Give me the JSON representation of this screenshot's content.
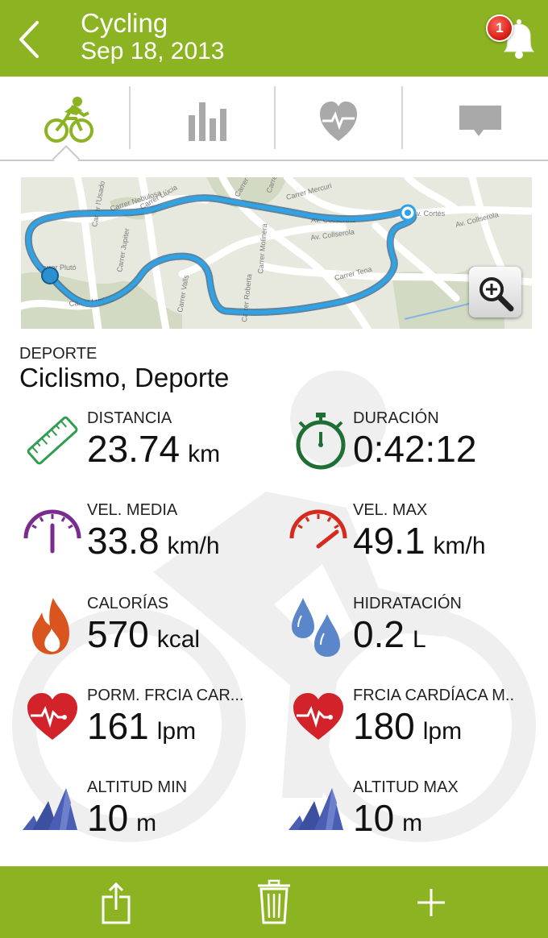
{
  "header": {
    "title": "Cycling",
    "date": "Sep 18, 2013",
    "notification_count": "1"
  },
  "tabs": [
    "cycling",
    "chart",
    "heart-rate",
    "comments"
  ],
  "map": {
    "streets": [
      "Carrer Nebulosa",
      "Carrer Llúcia",
      "Carrer l'Usado",
      "Carrer Jupiter",
      "Carrer Valls",
      "Av. Collserola",
      "Av. Collserola",
      "Carrer Llúcia",
      "Carrer Manila",
      "Carrer Molinera",
      "Carrer Roberta",
      "Av. Collserola",
      "Carrer Tena",
      "Carrer Lucien",
      "Av. Cortès",
      "Carrer Plutó",
      "Carrer Mercuri"
    ]
  },
  "sport": {
    "label": "DEPORTE",
    "value": "Ciclismo, Deporte"
  },
  "stats": [
    {
      "label": "DISTANCIA",
      "value": "23.74",
      "unit": "km",
      "icon": "ruler-icon"
    },
    {
      "label": "DURACIÓN",
      "value": "0:42:12",
      "unit": "",
      "icon": "stopwatch-icon"
    },
    {
      "label": "VEL. MEDIA",
      "value": "33.8",
      "unit": "km/h",
      "icon": "speedometer-icon"
    },
    {
      "label": "VEL. MAX",
      "value": "49.1",
      "unit": "km/h",
      "icon": "speedometer-max-icon"
    },
    {
      "label": "CALORÍAS",
      "value": "570",
      "unit": "kcal",
      "icon": "flame-icon"
    },
    {
      "label": "HIDRATACIÓN",
      "value": "0.2",
      "unit": "L",
      "icon": "water-drops-icon"
    },
    {
      "label": "PORM. FRCIA CAR...",
      "value": "161",
      "unit": "lpm",
      "icon": "heart-rate-icon"
    },
    {
      "label": "FRCIA CARDÍACA M..",
      "value": "180",
      "unit": "lpm",
      "icon": "heart-rate-max-icon"
    },
    {
      "label": "ALTITUD MIN",
      "value": "10",
      "unit": "m",
      "icon": "mountain-icon"
    },
    {
      "label": "ALTITUD MAX",
      "value": "10",
      "unit": "m",
      "icon": "mountain-max-icon"
    }
  ],
  "footer": [
    "share-icon",
    "trash-icon",
    "plus-icon"
  ],
  "colors": {
    "brand": "#8cb321",
    "route": "#1b8fd6",
    "ruler": "#2f9e4f",
    "speed_avg": "#7a2b8e",
    "speed_max": "#d42b1e",
    "flame": "#d9541e",
    "water": "#5b86c9",
    "heart": "#d2232a",
    "mountain": "#4a5fb3"
  }
}
